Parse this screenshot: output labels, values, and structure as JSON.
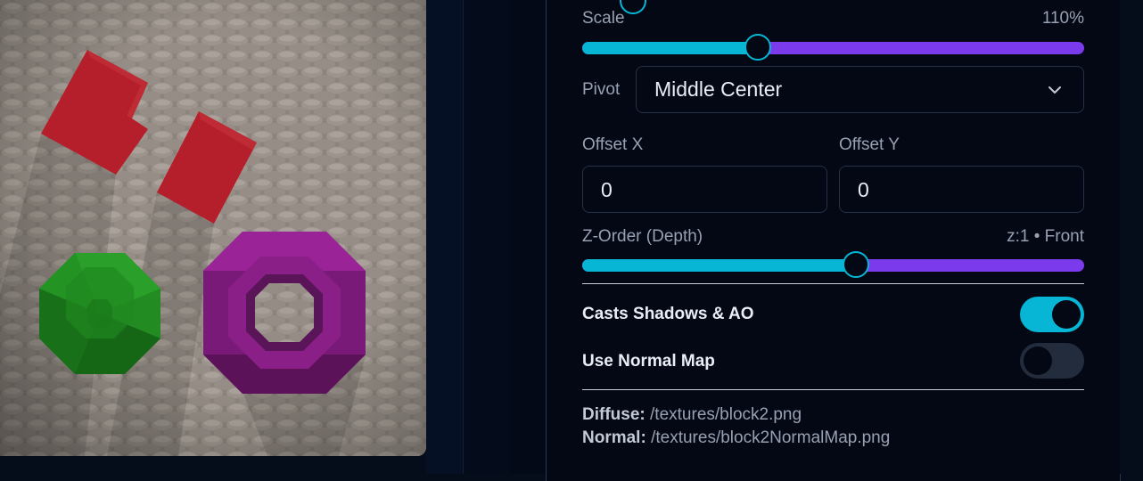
{
  "panel": {
    "scale": {
      "label": "Scale",
      "value_text": "110%",
      "fraction": 0.35
    },
    "pivot": {
      "label": "Pivot",
      "selected": "Middle Center"
    },
    "offset_x": {
      "label": "Offset X",
      "value": "0"
    },
    "offset_y": {
      "label": "Offset Y",
      "value": "0"
    },
    "z_order": {
      "label": "Z-Order (Depth)",
      "value_text": "z:1 • Front",
      "fraction": 0.545
    },
    "casts_shadows": {
      "label": "Casts Shadows & AO",
      "on": true
    },
    "normal_map": {
      "label": "Use Normal Map",
      "on": false
    },
    "paths": {
      "diffuse_label": "Diffuse:",
      "diffuse_value": "/textures/block2.png",
      "normal_label": "Normal:",
      "normal_value": "/textures/block2NormalMap.png"
    }
  },
  "colors": {
    "accent": "#06b6d4",
    "track": "#7c3aed",
    "red_block": "#b51f2b",
    "green_block": "#1f8a1f",
    "purple_block": "#8a1f88"
  },
  "icons": {
    "pivot_dropdown": "chevron-down-icon"
  }
}
